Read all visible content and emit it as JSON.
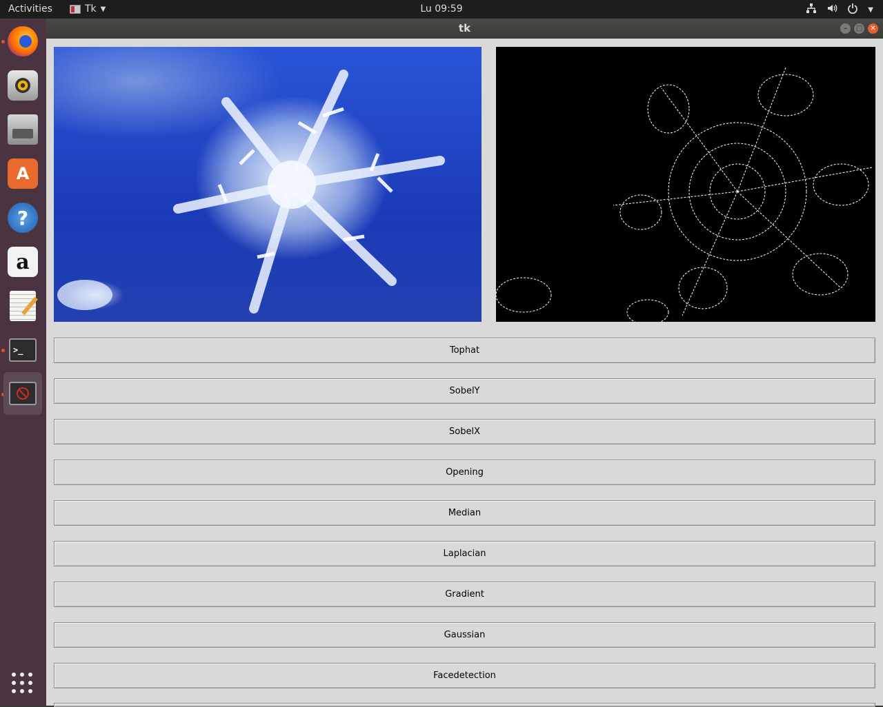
{
  "topbar": {
    "activities": "Activities",
    "app_name": "Tk",
    "clock": "Lu 09:59",
    "icons": [
      "network-icon",
      "volume-icon",
      "power-icon",
      "chevron-down-icon"
    ]
  },
  "dock": {
    "items": [
      {
        "name": "firefox",
        "running": true
      },
      {
        "name": "rhythmbox",
        "running": false
      },
      {
        "name": "files",
        "running": false
      },
      {
        "name": "software-center",
        "running": false
      },
      {
        "name": "help",
        "running": false
      },
      {
        "name": "amazon",
        "running": false
      },
      {
        "name": "text-editor",
        "running": false
      },
      {
        "name": "terminal",
        "running": true
      },
      {
        "name": "tk-app",
        "running": true,
        "active": true
      }
    ],
    "show_apps": "apps-grid-icon"
  },
  "window": {
    "title": "tk",
    "images": {
      "left": "snowflake photo on blue background",
      "right": "edge detection output (white edges on black)"
    },
    "buttons": [
      "Tophat",
      "SobelY",
      "SobelX",
      "Opening",
      "Median",
      "Laplacian",
      "Gradient",
      "Gaussian",
      "Facedetection"
    ]
  },
  "colors": {
    "dock": "#4a3442",
    "topbar": "#1d1d1d",
    "window_bg": "#d9d9d9",
    "close_button": "#e35d2e",
    "running_dot": "#e95420"
  }
}
